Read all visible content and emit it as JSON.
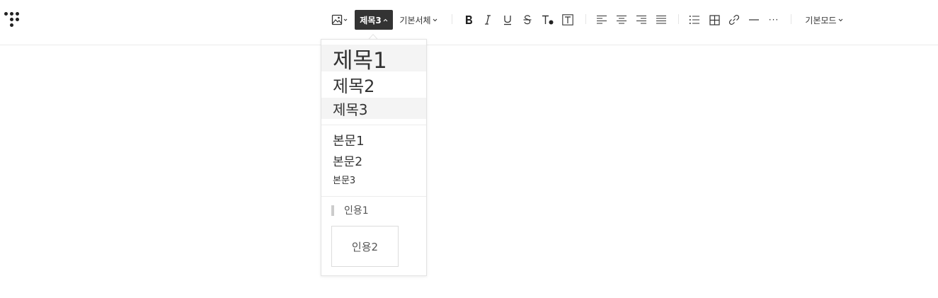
{
  "toolbar": {
    "heading_label": "제목3",
    "font_label": "기본서체",
    "mode_label": "기본모드",
    "more_label": "···"
  },
  "dropdown": {
    "headings": [
      "제목1",
      "제목2",
      "제목3"
    ],
    "bodies": [
      "본문1",
      "본문2",
      "본문3"
    ],
    "quotes": [
      "인용1",
      "인용2"
    ]
  },
  "colors": {
    "accent": "#333333",
    "divider": "#ececec",
    "hover": "#f4f4f4"
  }
}
